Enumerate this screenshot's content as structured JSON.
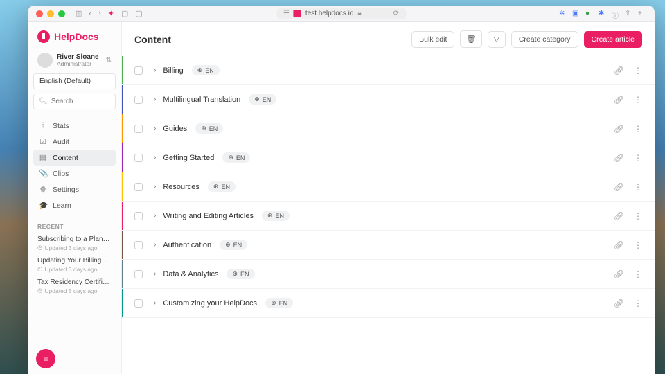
{
  "browser": {
    "url": "test.helpdocs.io",
    "right_icons": [
      "✲",
      "▣",
      "●",
      "✱",
      "ⓘ",
      "⇧",
      "+"
    ]
  },
  "brand": {
    "name": "HelpDocs"
  },
  "user": {
    "name": "River Sloane",
    "role": "Administrator"
  },
  "language_selector": "English (Default)",
  "search": {
    "placeholder": "Search"
  },
  "nav": [
    {
      "icon": "stats-icon",
      "glyph": "⫯",
      "label": "Stats"
    },
    {
      "icon": "audit-icon",
      "glyph": "☑",
      "label": "Audit"
    },
    {
      "icon": "content-icon",
      "glyph": "▤",
      "label": "Content",
      "active": true
    },
    {
      "icon": "clips-icon",
      "glyph": "📎",
      "label": "Clips"
    },
    {
      "icon": "settings-icon",
      "glyph": "⚙",
      "label": "Settings"
    },
    {
      "icon": "learn-icon",
      "glyph": "🎓",
      "label": "Learn"
    }
  ],
  "recent_header": "RECENT",
  "recent": [
    {
      "title": "Subscribing to a Plan for the …",
      "meta": "Updated 3 days ago"
    },
    {
      "title": "Updating Your Billing Informa…",
      "meta": "Updated 3 days ago"
    },
    {
      "title": "Tax Residency Certificates a…",
      "meta": "Updated 5 days ago"
    }
  ],
  "page": {
    "title": "Content"
  },
  "actions": {
    "bulk_edit": "Bulk edit",
    "create_category": "Create category",
    "create_article": "Create article"
  },
  "lang_badge": "EN",
  "rows": [
    {
      "title": "Billing"
    },
    {
      "title": "Multilingual Translation"
    },
    {
      "title": "Guides"
    },
    {
      "title": "Getting Started"
    },
    {
      "title": "Resources"
    },
    {
      "title": "Writing and Editing Articles"
    },
    {
      "title": "Authentication"
    },
    {
      "title": "Data & Analytics"
    },
    {
      "title": "Customizing your HelpDocs"
    }
  ]
}
